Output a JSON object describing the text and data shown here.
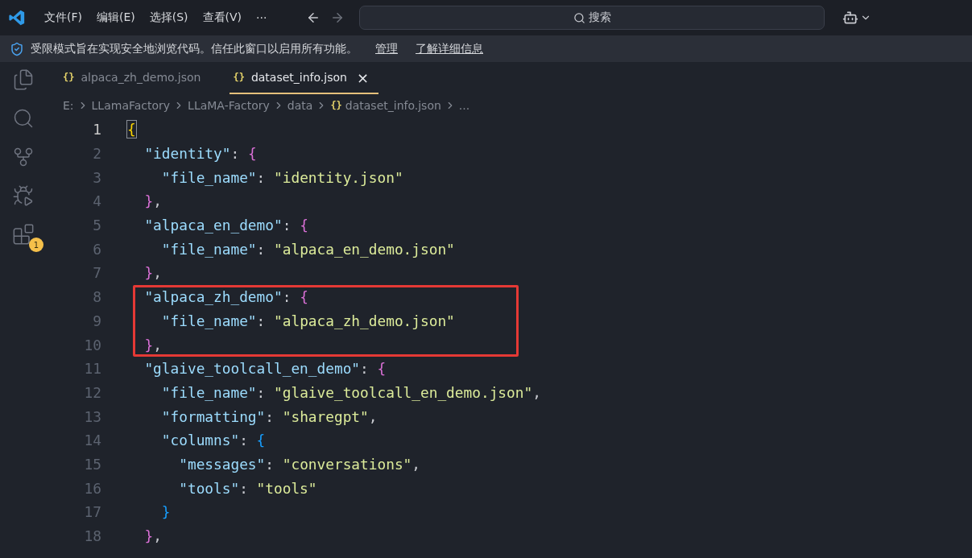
{
  "menu": [
    {
      "label": "文件(F)"
    },
    {
      "label": "编辑(E)"
    },
    {
      "label": "选择(S)"
    },
    {
      "label": "查看(V)"
    },
    {
      "label": "···"
    }
  ],
  "search": {
    "placeholder": "搜索"
  },
  "banner": {
    "text": "受限模式旨在实现安全地浏览代码。信任此窗口以启用所有功能。",
    "links": [
      "管理",
      "了解详细信息"
    ]
  },
  "activity_badge": "1",
  "tabs": [
    {
      "icon": "{}",
      "label": "alpaca_zh_demo.json",
      "selected": false
    },
    {
      "icon": "{}",
      "label": "dataset_info.json",
      "selected": true,
      "close": "×"
    }
  ],
  "breadcrumb": [
    {
      "label": "E:"
    },
    {
      "label": "LLamaFactory"
    },
    {
      "label": "LLaMA-Factory"
    },
    {
      "label": "data"
    },
    {
      "icon": "{}",
      "label": "dataset_info.json"
    },
    {
      "label": "..."
    }
  ],
  "lines": [
    {
      "number": "1",
      "active": true,
      "highlighted": false,
      "tokens": [
        {
          "kind": "brace",
          "text": "{",
          "color": "#ffd700"
        }
      ]
    },
    {
      "number": "2",
      "active": false,
      "highlighted": false,
      "tokens": [
        {
          "kind": "key",
          "text": "  \"identity\""
        },
        {
          "kind": "punct",
          "text": ": "
        },
        {
          "kind": "brace",
          "text": "{",
          "color": "#da70d6"
        }
      ]
    },
    {
      "number": "3",
      "active": false,
      "highlighted": false,
      "tokens": [
        {
          "kind": "key",
          "text": "    \"file_name\""
        },
        {
          "kind": "punct",
          "text": ": "
        },
        {
          "kind": "string",
          "text": "\"identity.json\""
        }
      ]
    },
    {
      "number": "4",
      "active": false,
      "highlighted": false,
      "tokens": [
        {
          "kind": "brace",
          "text": "  }",
          "color": "#da70d6"
        },
        {
          "kind": "punct",
          "text": ","
        }
      ]
    },
    {
      "number": "5",
      "active": false,
      "highlighted": false,
      "tokens": [
        {
          "kind": "key",
          "text": "  \"alpaca_en_demo\""
        },
        {
          "kind": "punct",
          "text": ": "
        },
        {
          "kind": "brace",
          "text": "{",
          "color": "#da70d6"
        }
      ]
    },
    {
      "number": "6",
      "active": false,
      "highlighted": false,
      "tokens": [
        {
          "kind": "key",
          "text": "    \"file_name\""
        },
        {
          "kind": "punct",
          "text": ": "
        },
        {
          "kind": "string",
          "text": "\"alpaca_en_demo.json\""
        }
      ]
    },
    {
      "number": "7",
      "active": false,
      "highlighted": false,
      "tokens": [
        {
          "kind": "brace",
          "text": "  }",
          "color": "#da70d6"
        },
        {
          "kind": "punct",
          "text": ","
        }
      ]
    },
    {
      "number": "8",
      "active": false,
      "highlighted": true,
      "tokens": [
        {
          "kind": "key",
          "text": "  \"alpaca_zh_demo\""
        },
        {
          "kind": "punct",
          "text": ": "
        },
        {
          "kind": "brace",
          "text": "{",
          "color": "#da70d6"
        }
      ]
    },
    {
      "number": "9",
      "active": false,
      "highlighted": true,
      "tokens": [
        {
          "kind": "key",
          "text": "    \"file_name\""
        },
        {
          "kind": "punct",
          "text": ": "
        },
        {
          "kind": "string",
          "text": "\"alpaca_zh_demo.json\""
        }
      ]
    },
    {
      "number": "10",
      "active": false,
      "highlighted": true,
      "tokens": [
        {
          "kind": "brace",
          "text": "  }",
          "color": "#da70d6"
        },
        {
          "kind": "punct",
          "text": ","
        }
      ]
    },
    {
      "number": "11",
      "active": false,
      "highlighted": false,
      "tokens": [
        {
          "kind": "key",
          "text": "  \"glaive_toolcall_en_demo\""
        },
        {
          "kind": "punct",
          "text": ": "
        },
        {
          "kind": "brace",
          "text": "{",
          "color": "#da70d6"
        }
      ]
    },
    {
      "number": "12",
      "active": false,
      "highlighted": false,
      "tokens": [
        {
          "kind": "key",
          "text": "    \"file_name\""
        },
        {
          "kind": "punct",
          "text": ": "
        },
        {
          "kind": "string",
          "text": "\"glaive_toolcall_en_demo.json\""
        },
        {
          "kind": "punct",
          "text": ","
        }
      ]
    },
    {
      "number": "13",
      "active": false,
      "highlighted": false,
      "tokens": [
        {
          "kind": "key",
          "text": "    \"formatting\""
        },
        {
          "kind": "punct",
          "text": ": "
        },
        {
          "kind": "string",
          "text": "\"sharegpt\""
        },
        {
          "kind": "punct",
          "text": ","
        }
      ]
    },
    {
      "number": "14",
      "active": false,
      "highlighted": false,
      "tokens": [
        {
          "kind": "key",
          "text": "    \"columns\""
        },
        {
          "kind": "punct",
          "text": ": "
        },
        {
          "kind": "brace",
          "text": "{",
          "color": "#179fff"
        }
      ]
    },
    {
      "number": "15",
      "active": false,
      "highlighted": false,
      "tokens": [
        {
          "kind": "key",
          "text": "      \"messages\""
        },
        {
          "kind": "punct",
          "text": ": "
        },
        {
          "kind": "string",
          "text": "\"conversations\""
        },
        {
          "kind": "punct",
          "text": ","
        }
      ]
    },
    {
      "number": "16",
      "active": false,
      "highlighted": false,
      "tokens": [
        {
          "kind": "key",
          "text": "      \"tools\""
        },
        {
          "kind": "punct",
          "text": ": "
        },
        {
          "kind": "string",
          "text": "\"tools\""
        }
      ]
    },
    {
      "number": "17",
      "active": false,
      "highlighted": false,
      "tokens": [
        {
          "kind": "brace",
          "text": "    }",
          "color": "#179fff"
        }
      ]
    },
    {
      "number": "18",
      "active": false,
      "highlighted": false,
      "tokens": [
        {
          "kind": "brace",
          "text": "  }",
          "color": "#da70d6"
        },
        {
          "kind": "punct",
          "text": ","
        }
      ]
    }
  ]
}
